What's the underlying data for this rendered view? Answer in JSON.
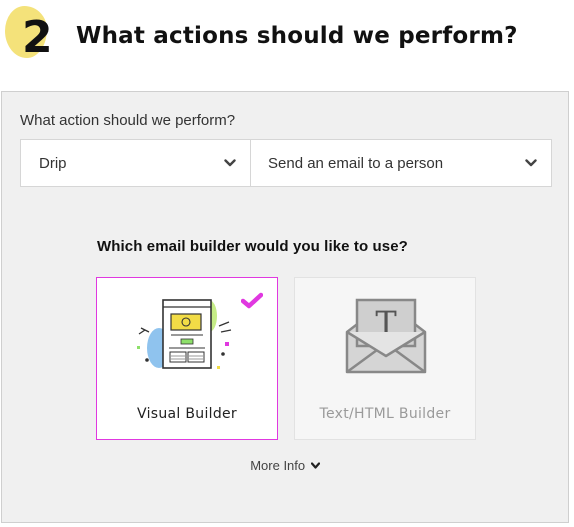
{
  "step": {
    "number": "2",
    "title": "What actions should we perform?"
  },
  "action": {
    "label": "What action should we perform?",
    "app_value": "Drip",
    "action_value": "Send an email to a person"
  },
  "builder": {
    "question": "Which email builder would you like to use?",
    "options": [
      {
        "label": "Visual Builder",
        "selected": true
      },
      {
        "label": "Text/HTML Builder",
        "selected": false
      }
    ],
    "more_info": "More Info"
  },
  "colors": {
    "accent_magenta": "#e038e0",
    "badge_yellow": "#f4e27a",
    "panel_bg": "#f0f0f0"
  },
  "icons": {
    "select_chevron": "chevron-down-icon",
    "selected_mark": "checkmark-icon",
    "visual_builder": "visual-builder-illustration",
    "text_builder": "envelope-letter-t-icon",
    "more_info_caret": "caret-down-icon"
  }
}
